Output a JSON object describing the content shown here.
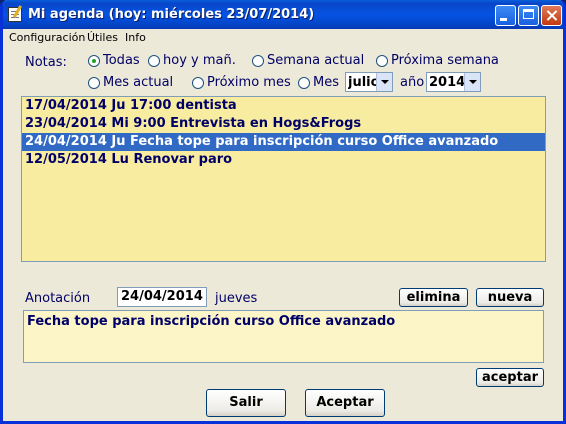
{
  "window": {
    "title": "Mi agenda  (hoy: miércoles 23/07/2014)"
  },
  "menu": [
    "Configuración",
    "Útiles",
    "Info"
  ],
  "filters": {
    "notas_label": "Notas:",
    "options": [
      "Todas",
      "hoy y mañ.",
      "Semana actual",
      "Próxima semana",
      "Mes actual",
      "Próximo mes",
      "Mes"
    ],
    "selected": "Todas",
    "month_value": "julio",
    "year_label": "año",
    "year_value": "2014"
  },
  "notes": [
    "17/04/2014 Ju 17:00 dentista",
    "23/04/2014 Mi 9:00 Entrevista en Hogs&Frogs",
    "24/04/2014 Ju Fecha tope para inscripción curso Office avanzado",
    "12/05/2014 Lu Renovar paro"
  ],
  "selected_note_index": 2,
  "annotation": {
    "label": "Anotación",
    "date_value": "24/04/2014",
    "weekday": "jueves",
    "text": "Fecha tope para inscripción curso Office avanzado"
  },
  "buttons": {
    "elimina": "elimina",
    "nueva": "nueva",
    "aceptar_small": "aceptar",
    "salir": "Salir",
    "aceptar": "Aceptar"
  }
}
